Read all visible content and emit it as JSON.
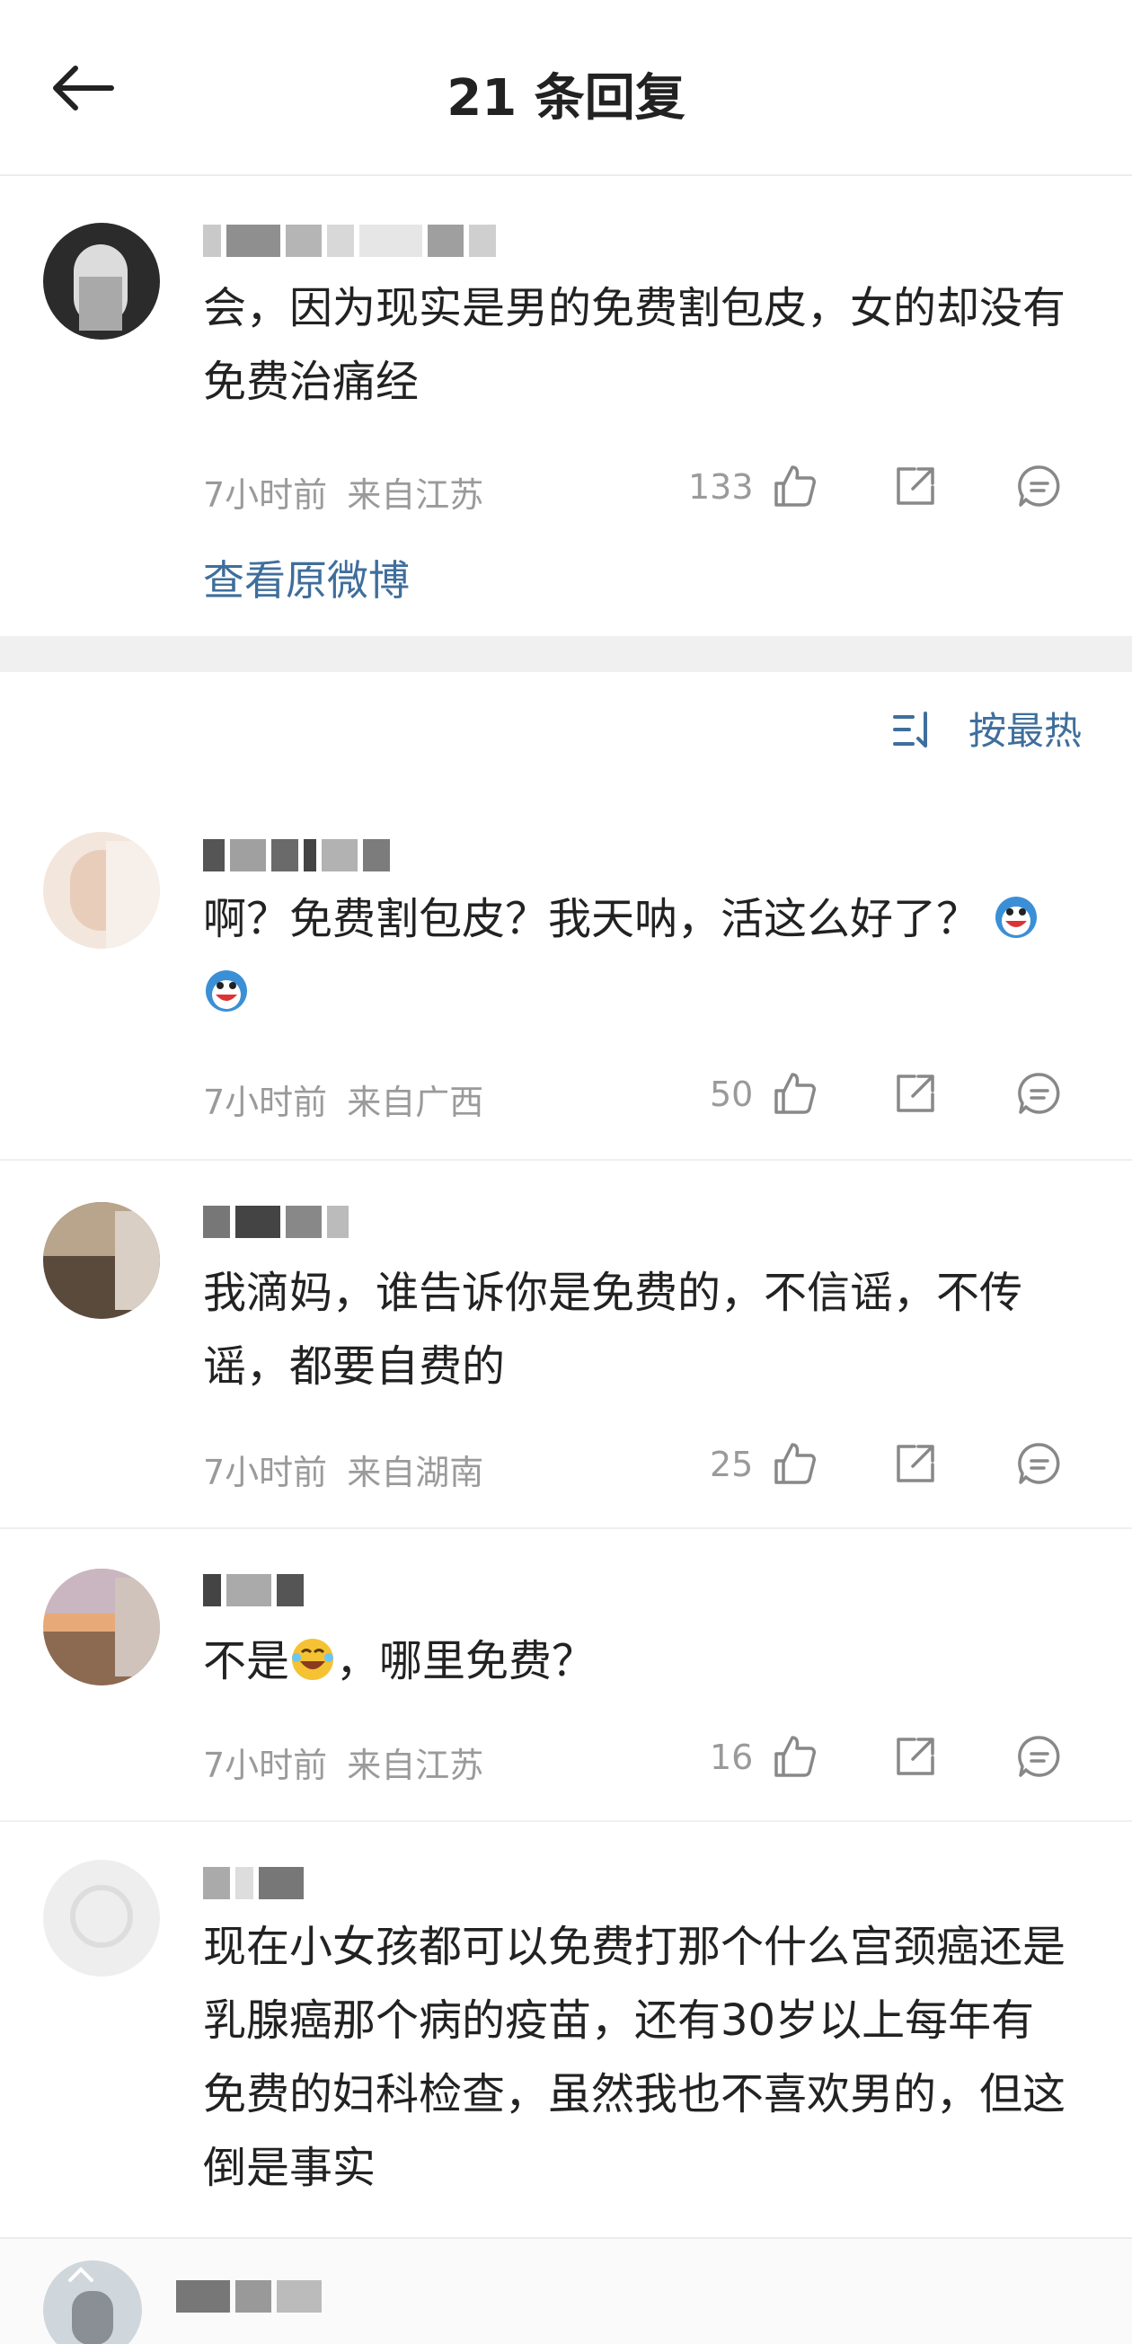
{
  "header": {
    "title": "21 条回复"
  },
  "main_post": {
    "text": "会，因为现实是男的免费割包皮，女的却没有免费治痛经",
    "time": "7小时前",
    "location": "来自江苏",
    "likes": "133",
    "view_original": "查看原微博"
  },
  "sort": {
    "label": "按最热"
  },
  "comments": [
    {
      "text": "啊？免费割包皮？我天呐，活这么好了？",
      "time": "7小时前",
      "location": "来自广西",
      "likes": "50"
    },
    {
      "text": "我滴妈，谁告诉你是免费的，不信谣，不传谣，都要自费的",
      "time": "7小时前",
      "location": "来自湖南",
      "likes": "25"
    },
    {
      "text_before": "不是",
      "text_after": "，哪里免费？",
      "time": "7小时前",
      "location": "来自江苏",
      "likes": "16"
    },
    {
      "text": "现在小女孩都可以免费打那个什么宫颈癌还是乳腺癌那个病的疫苗，还有30岁以上每年有免费的妇科检查，虽然我也不喜欢男的，但这倒是事实"
    }
  ],
  "colors": {
    "link": "#3f6e9c",
    "meta": "#9a9a9a",
    "text": "#222222",
    "background": "#ffffff"
  },
  "icons": [
    "back-arrow-icon",
    "thumbs-up-icon",
    "share-icon",
    "comment-icon",
    "sort-icon",
    "laughing-emoji-icon",
    "crying-laugh-emoji-icon"
  ]
}
